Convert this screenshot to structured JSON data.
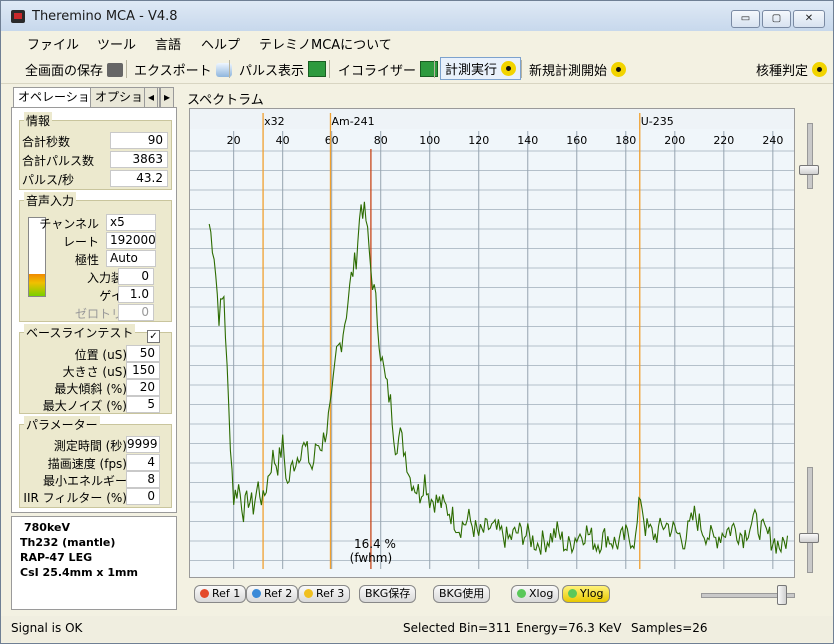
{
  "window": {
    "title": "Theremino MCA - V4.8",
    "min_label": "▭",
    "max_label": "▢",
    "close_label": "✕"
  },
  "menu": [
    "ファイル",
    "ツール",
    "言語",
    "ヘルプ",
    "テレミノMCAについて"
  ],
  "toolbar": {
    "save": "全画面の保存",
    "export": "エクスポート",
    "pulse": "パルス表示",
    "equalizer": "イコライザー",
    "measure_run": "計測実行",
    "new_measure": "新規計測開始",
    "nuclide": "核種判定"
  },
  "tabs": {
    "operation": "オペレーション",
    "options": "オプション",
    "prev": "◂",
    "next": "▸"
  },
  "info": {
    "title": "情報",
    "total_seconds_label": "合計秒数",
    "total_seconds": "90",
    "total_pulses_label": "合計パルス数",
    "total_pulses": "3863",
    "pulses_per_sec_label": "パルス/秒",
    "pulses_per_sec": "43.2"
  },
  "audio": {
    "title": "音声入力",
    "level_fraction": 0.28,
    "channel_label": "チャンネル",
    "channel": "x5",
    "rate_label": "レート",
    "rate": "192000",
    "polarity_label": "極性",
    "polarity": "Auto",
    "input_device_label": "入力装置",
    "input_device": "0",
    "gain_label": "ゲイン",
    "gain": "1.0",
    "zero_trim_label": "ゼロトリム",
    "zero_trim": "0"
  },
  "baseline": {
    "title": "ベースラインテスト",
    "checked": true,
    "position_label": "位置 (uS)",
    "position": "50",
    "size_label": "大きさ (uS)",
    "size": "150",
    "max_slope_label": "最大傾斜 (%)",
    "max_slope": "20",
    "max_noise_label": "最大ノイズ (%)",
    "max_noise": "5"
  },
  "params": {
    "title": "パラメーター",
    "measure_time_label": "測定時間 (秒)",
    "measure_time": "9999",
    "draw_speed_label": "描画速度 (fps)",
    "draw_speed": "4",
    "min_energy_label": "最小エネルギー",
    "min_energy": "8",
    "iir_label": "IIR フィルター (%)",
    "iir": "0"
  },
  "notes": [
    "780keV",
    "Th232 (mantle)",
    "RAP-47 LEG",
    "CsI 25.4mm x 1mm"
  ],
  "status": {
    "signal": "Signal is OK",
    "selected_bin": "Selected Bin=311",
    "energy": "Energy=76.3 KeV",
    "samples": "Samples=26"
  },
  "spectrum_label": "スペクトラム",
  "buttons": {
    "ref1": "Ref 1",
    "ref2": "Ref 2",
    "ref3": "Ref 3",
    "bkg_save": "BKG保存",
    "bkg_use": "BKG使用",
    "xlog": "Xlog",
    "ylog": "Ylog"
  },
  "colors": {
    "trace": "#2c6b00",
    "marker": "#f0a030",
    "peak_marker": "#c8481a",
    "grid": "#8a9aa8"
  },
  "chart_data": {
    "type": "line",
    "xlim": [
      3,
      247
    ],
    "ylim": [
      0,
      1
    ],
    "y_axis_labels": "none",
    "x_ticks": [
      20,
      40,
      60,
      80,
      100,
      120,
      140,
      160,
      180,
      200,
      220,
      240
    ],
    "markers": [
      {
        "label": "x32",
        "x": 32
      },
      {
        "label": "Am-241",
        "x": 59.5
      },
      {
        "label": "U-235",
        "x": 185.7
      }
    ],
    "peak_marker_x": 76,
    "fwhm_label": "16.4 %",
    "fwhm_sublabel": "(fwhm)",
    "series": [
      {
        "x": [
          10,
          12,
          14,
          16,
          18,
          20,
          22,
          24,
          26,
          28,
          30,
          32,
          34,
          36,
          38,
          40,
          42,
          44,
          46,
          48,
          50,
          52,
          54,
          56,
          58,
          60,
          62,
          64,
          66,
          68,
          70,
          72,
          74,
          76,
          78,
          80,
          82,
          84,
          86,
          88,
          90,
          92,
          94,
          96,
          98,
          100,
          104,
          108,
          112,
          116,
          120,
          124,
          128,
          132,
          136,
          140,
          144,
          148,
          152,
          156,
          160,
          164,
          168,
          172,
          176,
          180,
          184,
          186,
          188,
          192,
          196,
          200,
          204,
          208,
          212,
          216,
          220,
          224,
          228,
          232,
          236,
          240,
          244,
          246
        ],
        "y": [
          0.83,
          0.76,
          0.61,
          0.66,
          0.38,
          0.17,
          0.2,
          0.14,
          0.17,
          0.15,
          0.2,
          0.16,
          0.22,
          0.27,
          0.25,
          0.3,
          0.2,
          0.25,
          0.27,
          0.3,
          0.28,
          0.24,
          0.3,
          0.3,
          0.34,
          0.4,
          0.52,
          0.55,
          0.62,
          0.7,
          0.75,
          0.88,
          0.84,
          0.72,
          0.64,
          0.52,
          0.45,
          0.4,
          0.3,
          0.32,
          0.28,
          0.22,
          0.2,
          0.18,
          0.22,
          0.17,
          0.16,
          0.14,
          0.1,
          0.12,
          0.08,
          0.1,
          0.09,
          0.07,
          0.09,
          0.08,
          0.06,
          0.07,
          0.09,
          0.05,
          0.08,
          0.09,
          0.06,
          0.08,
          0.06,
          0.08,
          0.07,
          0.18,
          0.1,
          0.08,
          0.11,
          0.09,
          0.07,
          0.13,
          0.09,
          0.07,
          0.09,
          0.1,
          0.08,
          0.12,
          0.09,
          0.07,
          0.05,
          0.08
        ]
      }
    ]
  }
}
